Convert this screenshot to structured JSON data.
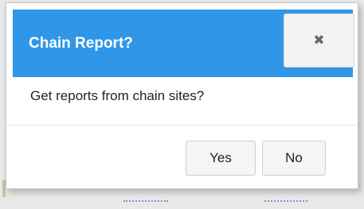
{
  "dialog": {
    "title": "Chain Report?",
    "message": "Get reports from chain sites?",
    "close_icon": "close-icon",
    "buttons": {
      "yes_label": "Yes",
      "no_label": "No"
    }
  },
  "colors": {
    "header_background": "#2f96e8",
    "header_text": "#ffffff",
    "button_background": "#f5f5f5"
  }
}
